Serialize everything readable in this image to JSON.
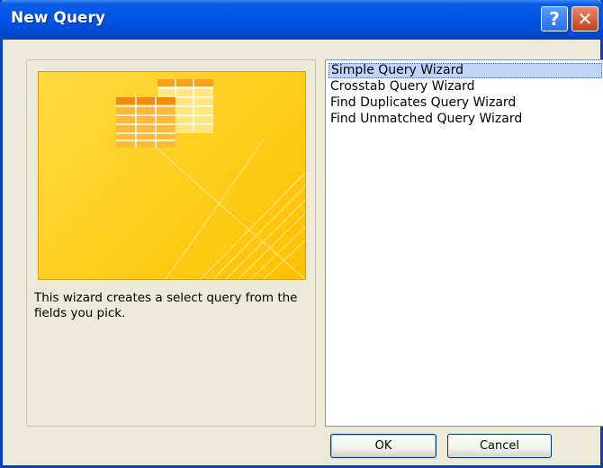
{
  "window": {
    "title": "New Query",
    "help_glyph": "?",
    "close_glyph": "✕"
  },
  "preview": {
    "icon": "table-grid-illustration",
    "description": "This wizard creates a select query from the fields you pick."
  },
  "wizards": [
    {
      "label": "Simple Query Wizard",
      "selected": true
    },
    {
      "label": "Crosstab Query Wizard",
      "selected": false
    },
    {
      "label": "Find Duplicates Query Wizard",
      "selected": false
    },
    {
      "label": "Find Unmatched Query Wizard",
      "selected": false
    }
  ],
  "buttons": {
    "ok": "OK",
    "cancel": "Cancel"
  },
  "colors": {
    "titlebar": "#0054e3",
    "preview_bg": "#ffcc22",
    "selection": "#c1d3fb"
  }
}
